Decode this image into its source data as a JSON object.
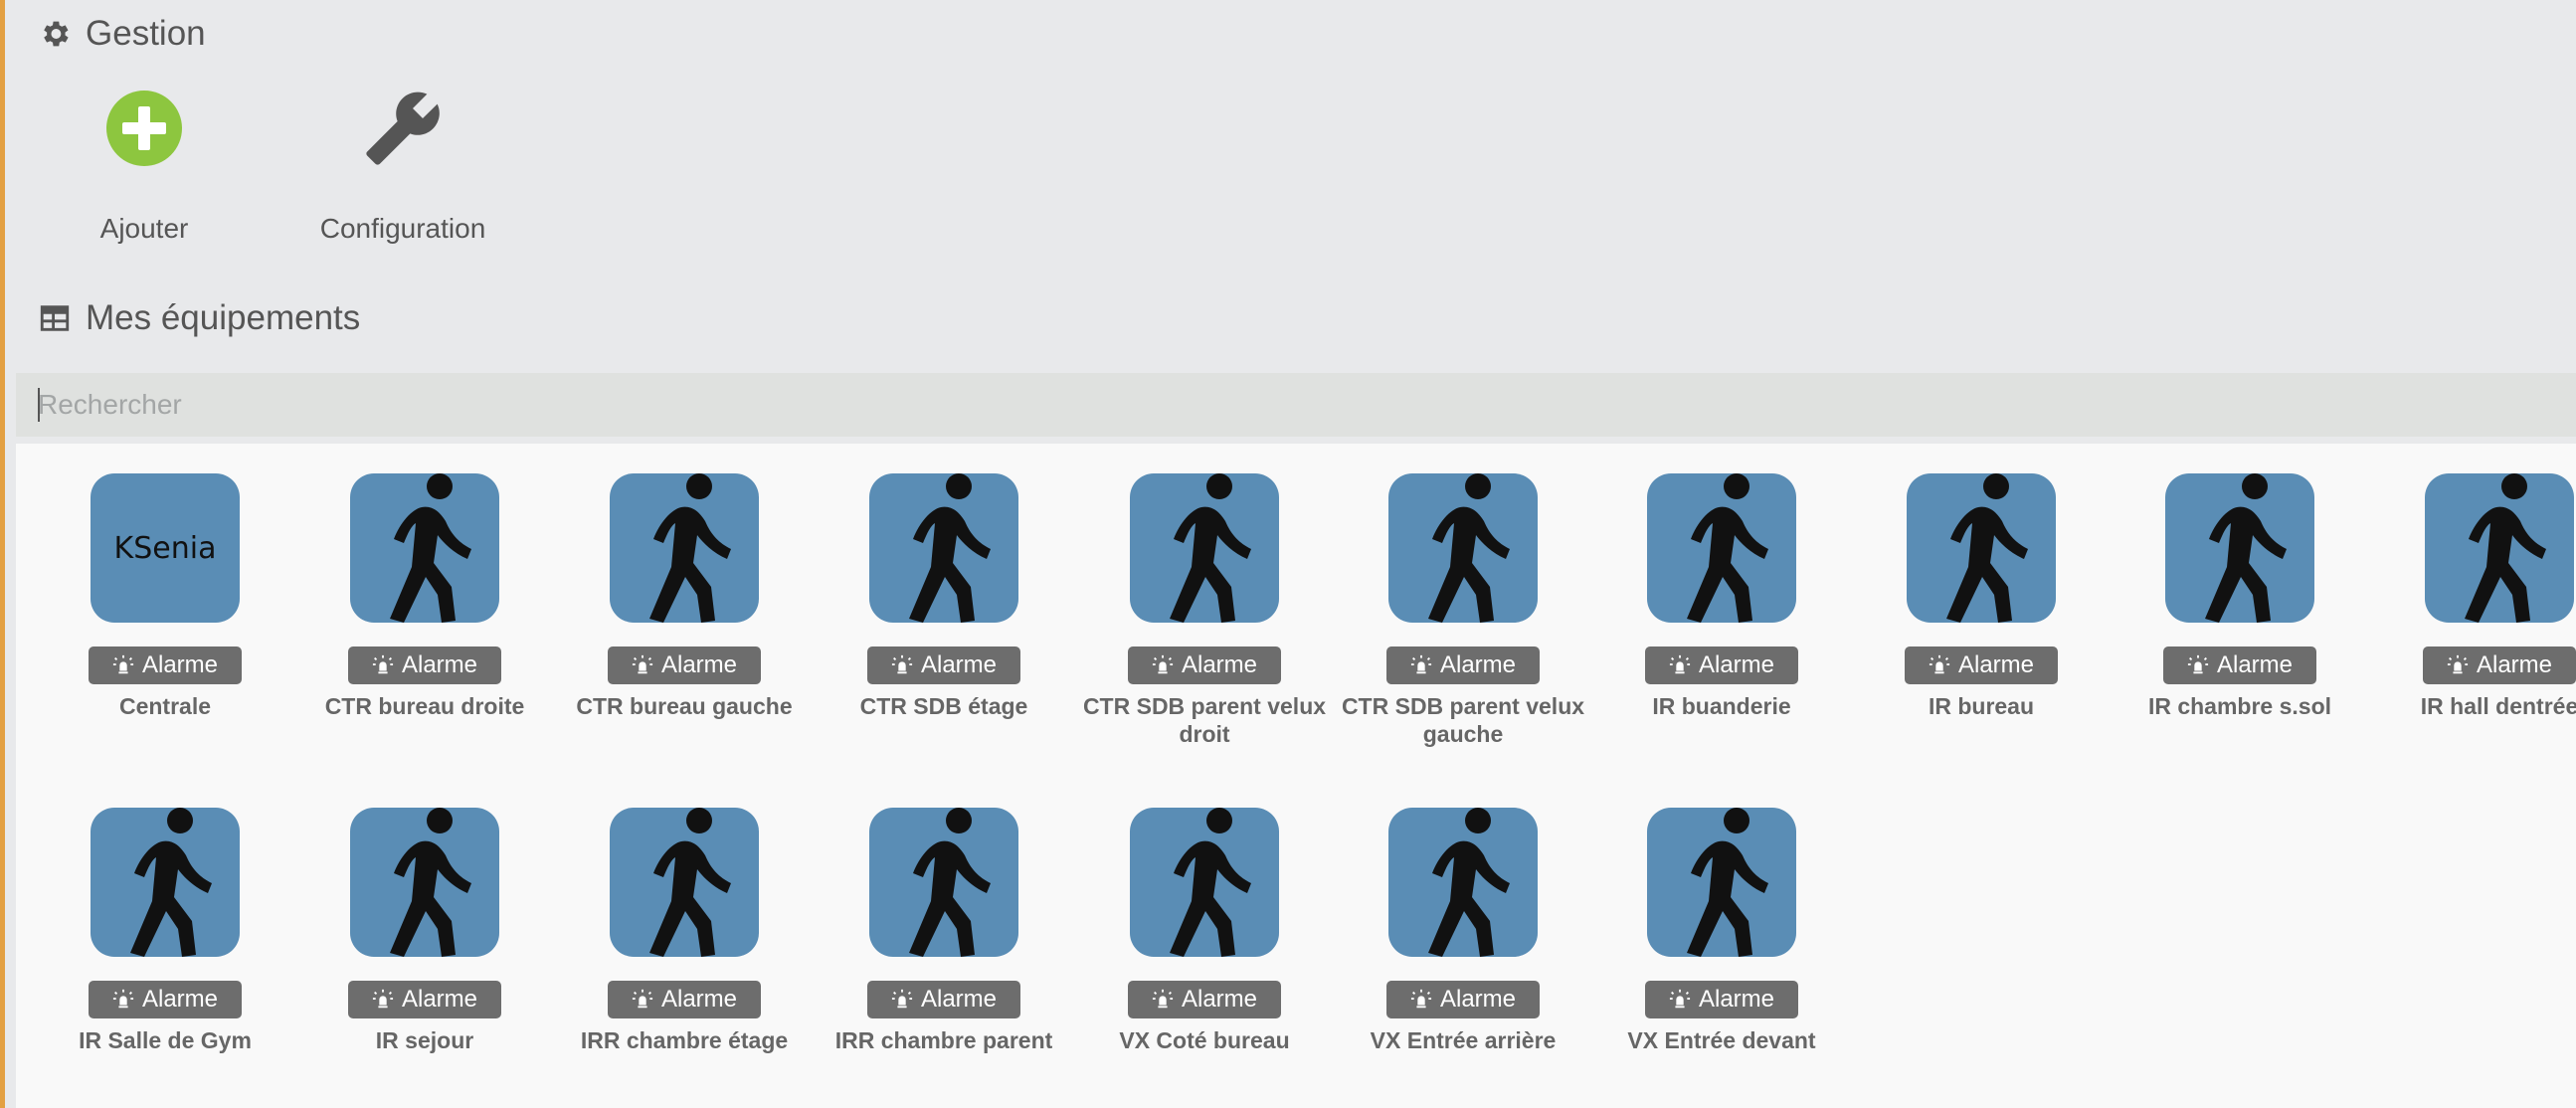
{
  "gestion": {
    "title": "Gestion",
    "title_icon": "gear-icon",
    "actions": [
      {
        "label": "Ajouter",
        "icon": "plus-circle-icon",
        "color": "#8dc63f"
      },
      {
        "label": "Configuration",
        "icon": "wrench-icon",
        "color": "#555555"
      }
    ]
  },
  "equipements": {
    "title": "Mes équipements",
    "title_icon": "table-icon",
    "search": {
      "placeholder": "Rechercher",
      "value": ""
    },
    "tile_color": "#5a8db5",
    "items": [
      {
        "name": "Centrale",
        "category": "Alarme",
        "icon": "ksenia-logo",
        "logo_text": "KSenia"
      },
      {
        "name": "CTR bureau droite",
        "category": "Alarme",
        "icon": "walking-person-icon"
      },
      {
        "name": "CTR bureau gauche",
        "category": "Alarme",
        "icon": "walking-person-icon"
      },
      {
        "name": "CTR SDB étage",
        "category": "Alarme",
        "icon": "walking-person-icon"
      },
      {
        "name": "CTR SDB parent velux droit",
        "category": "Alarme",
        "icon": "walking-person-icon"
      },
      {
        "name": "CTR SDB parent velux gauche",
        "category": "Alarme",
        "icon": "walking-person-icon"
      },
      {
        "name": "IR buanderie",
        "category": "Alarme",
        "icon": "walking-person-icon"
      },
      {
        "name": "IR bureau",
        "category": "Alarme",
        "icon": "walking-person-icon"
      },
      {
        "name": "IR chambre s.sol",
        "category": "Alarme",
        "icon": "walking-person-icon"
      },
      {
        "name": "IR hall dentrée",
        "category": "Alarme",
        "icon": "walking-person-icon"
      },
      {
        "name": "IR Salle de Gym",
        "category": "Alarme",
        "icon": "walking-person-icon"
      },
      {
        "name": "IR sejour",
        "category": "Alarme",
        "icon": "walking-person-icon"
      },
      {
        "name": "IRR chambre étage",
        "category": "Alarme",
        "icon": "walking-person-icon"
      },
      {
        "name": "IRR chambre parent",
        "category": "Alarme",
        "icon": "walking-person-icon"
      },
      {
        "name": "VX Coté bureau",
        "category": "Alarme",
        "icon": "walking-person-icon"
      },
      {
        "name": "VX Entrée arrière",
        "category": "Alarme",
        "icon": "walking-person-icon"
      },
      {
        "name": "VX Entrée devant",
        "category": "Alarme",
        "icon": "walking-person-icon"
      }
    ]
  }
}
